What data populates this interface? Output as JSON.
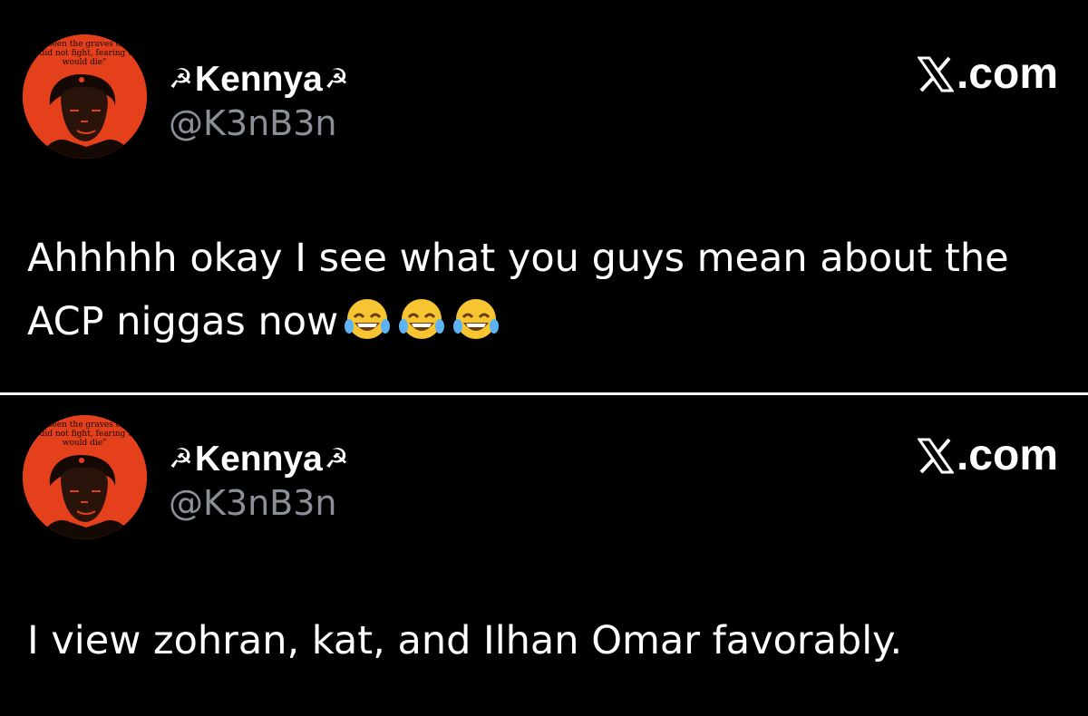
{
  "posts": [
    {
      "display_name": "Kennya",
      "name_symbol": "☭",
      "handle": "@K3nB3n",
      "site": ".com",
      "text": "Ahhhhh okay I see what you guys mean about the ACP niggas now",
      "emojis": [
        "face-with-tears-of-joy",
        "face-with-tears-of-joy",
        "face-with-tears-of-joy"
      ],
      "avatar_caption": [
        "seen the graves o",
        "o did not fight, fearing th",
        "would die\""
      ]
    },
    {
      "display_name": "Kennya",
      "name_symbol": "☭",
      "handle": "@K3nB3n",
      "site": ".com",
      "text": "I view zohran, kat, and Ilhan Omar favorably.",
      "emojis": [],
      "avatar_caption": [
        "seen the graves o",
        "o did not fight, fearing th",
        "would die\""
      ]
    }
  ],
  "colors": {
    "background": "#000000",
    "text": "#ffffff",
    "handle": "#8b9098",
    "avatar": "#e4401c",
    "divider": "#ffffff"
  }
}
